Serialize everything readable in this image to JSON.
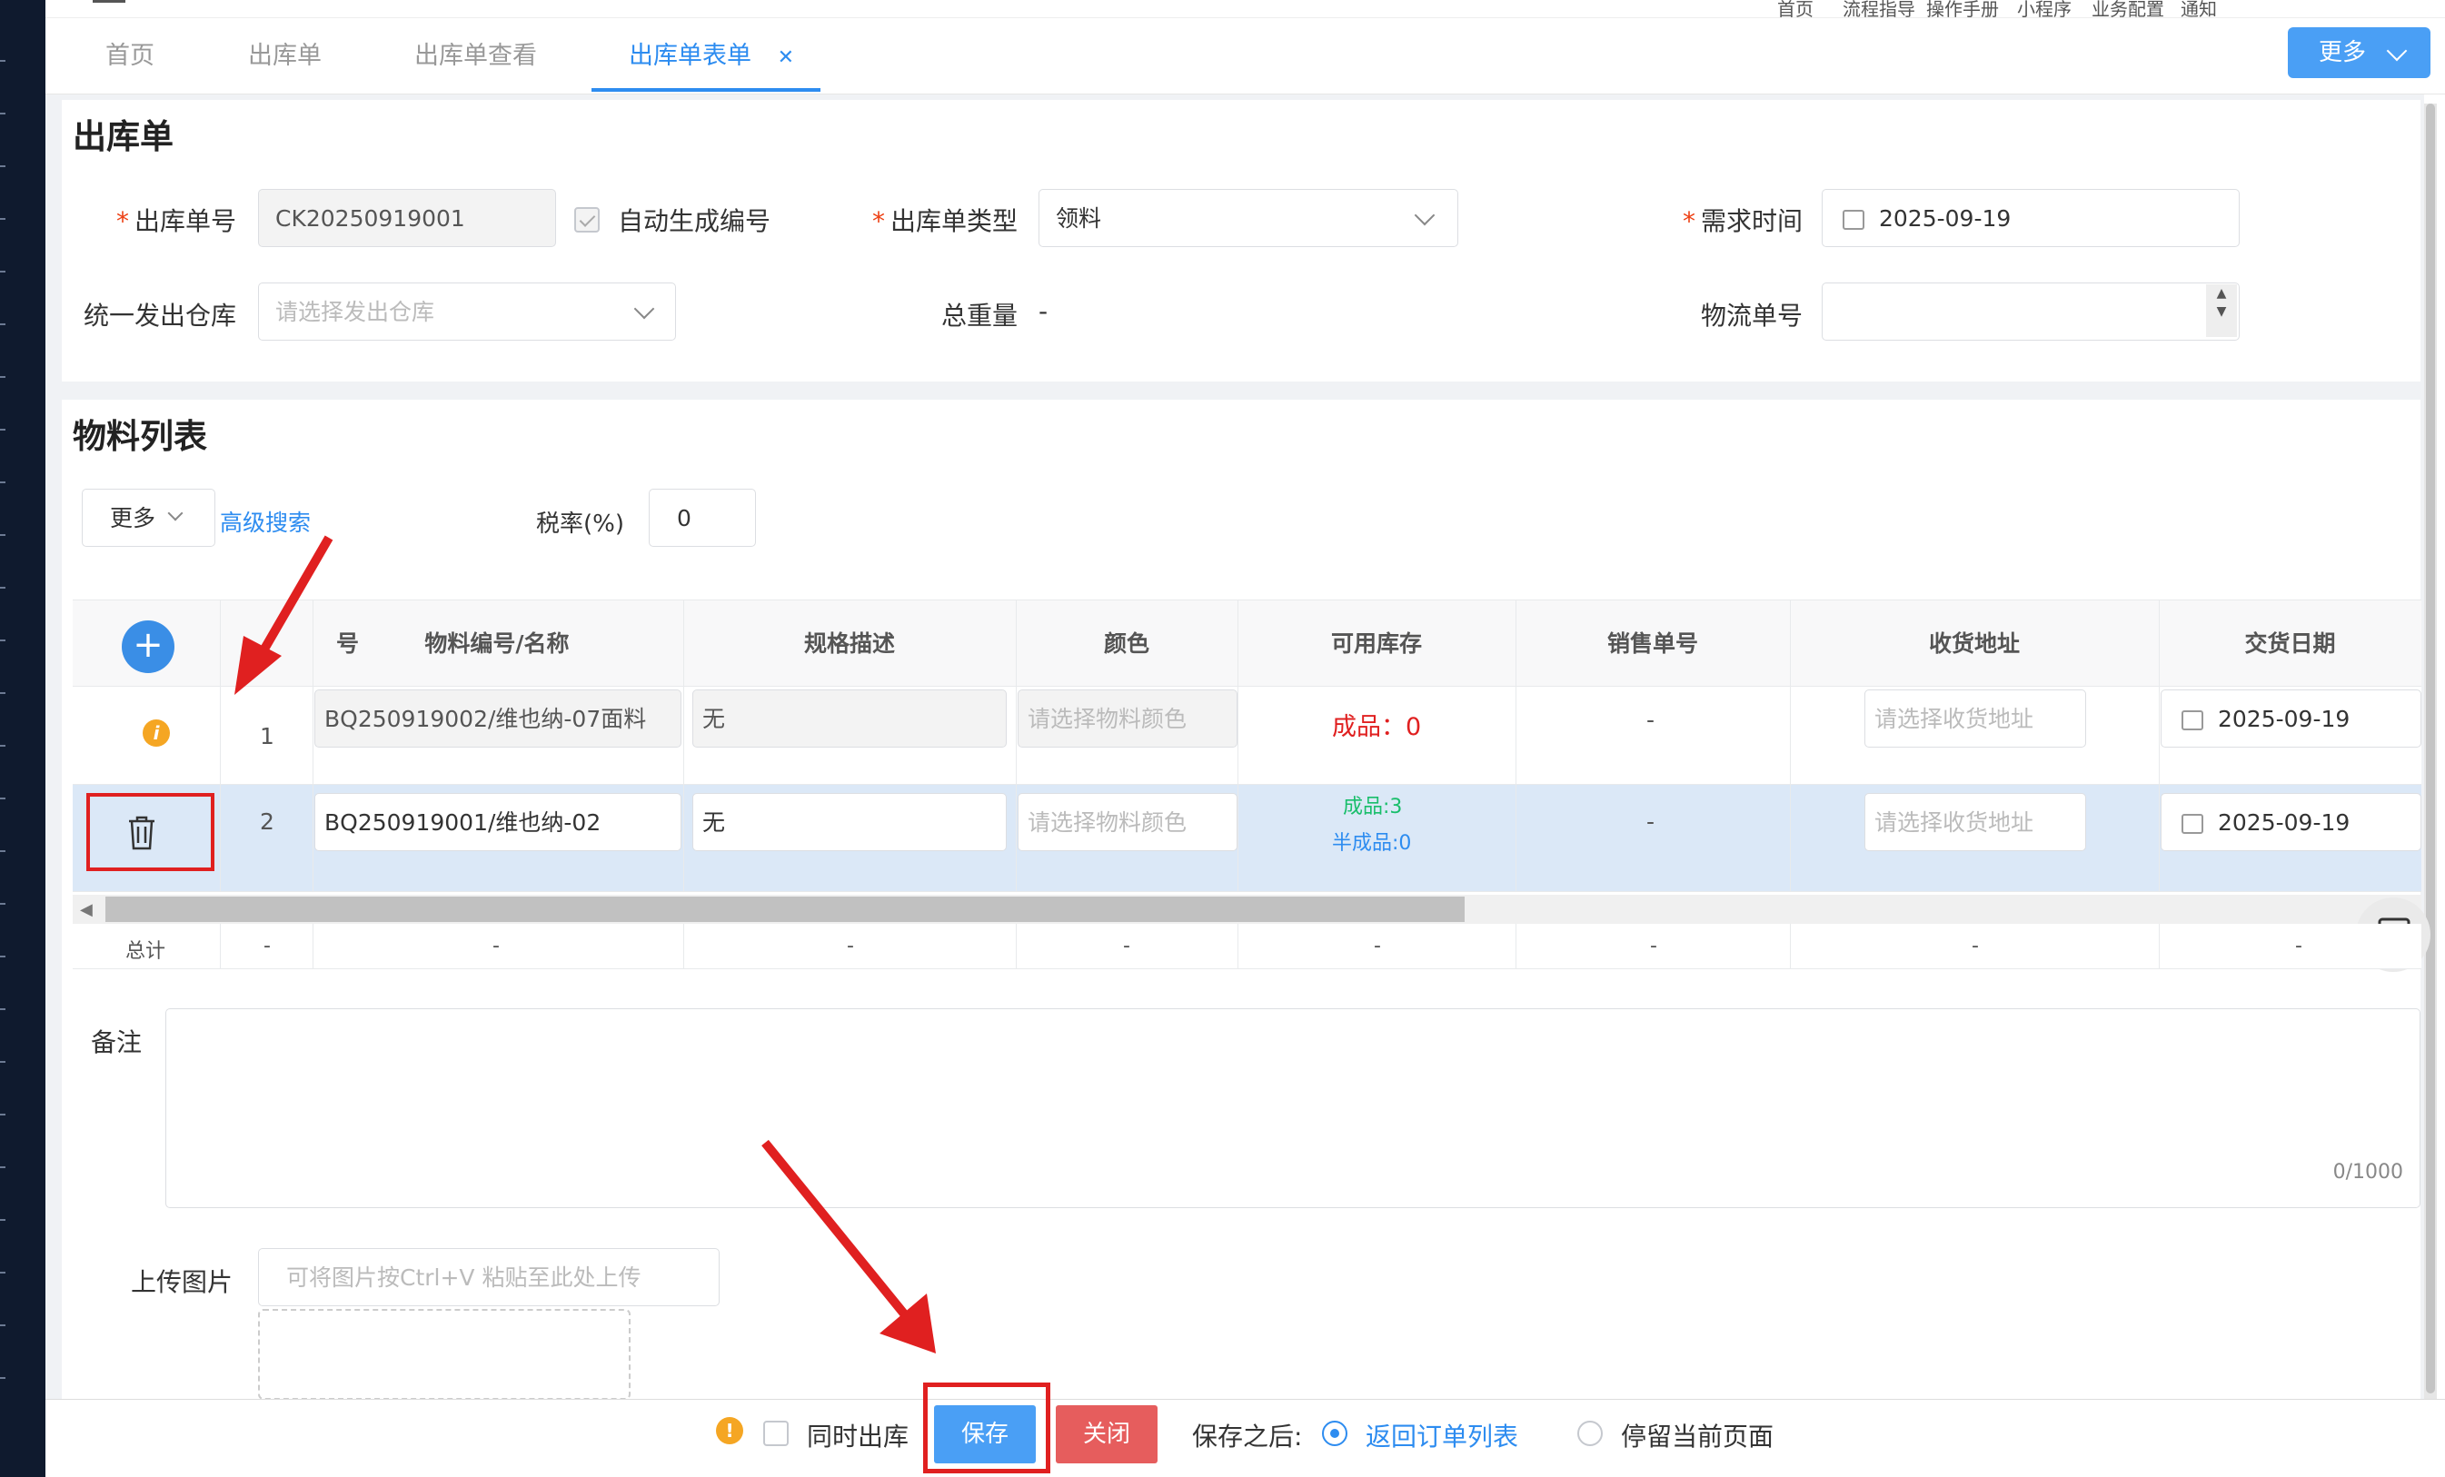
{
  "top_links": [
    "首页",
    "流程指导",
    "操作手册",
    "小程序",
    "业务配置",
    "通知"
  ],
  "tabs": [
    {
      "label": "首页",
      "active": false
    },
    {
      "label": "出库单",
      "active": false
    },
    {
      "label": "出库单查看",
      "active": false
    },
    {
      "label": "出库单表单",
      "active": true
    }
  ],
  "more_button": "更多",
  "form": {
    "title": "出库单",
    "order_no_label": "出库单号",
    "order_no_value": "CK20250919001",
    "auto_generate_label": "自动生成编号",
    "auto_generate_checked": true,
    "type_label": "出库单类型",
    "type_value": "领料",
    "demand_time_label": "需求时间",
    "demand_time_value": "2025-09-19",
    "warehouse_label": "统一发出仓库",
    "warehouse_placeholder": "请选择发出仓库",
    "total_weight_label": "总重量",
    "total_weight_value": "-",
    "logistics_label": "物流单号",
    "logistics_value": ""
  },
  "materials": {
    "title": "物料列表",
    "more_label": "更多",
    "advanced_search": "高级搜索",
    "tax_label": "税率(%)",
    "tax_value": "0",
    "columns": {
      "seq": "号",
      "code": "物料编号/名称",
      "spec": "规格描述",
      "color": "颜色",
      "stock": "可用库存",
      "sales_no": "销售单号",
      "address": "收货地址",
      "delivery": "交货日期"
    },
    "rows": [
      {
        "seq": "1",
        "code": "BQ250919002/维也纳-07面料",
        "spec": "无",
        "color_placeholder": "请选择物料颜色",
        "stock_label": "成品：0",
        "sales_no": "-",
        "address_placeholder": "请选择收货地址",
        "delivery": "2025-09-19"
      },
      {
        "seq": "2",
        "code": "BQ250919001/维也纳-02",
        "spec": "无",
        "color_placeholder": "请选择物料颜色",
        "stock_finished": "成品:3",
        "stock_semi": "半成品:0",
        "sales_no": "-",
        "address_placeholder": "请选择收货地址",
        "delivery": "2025-09-19"
      }
    ],
    "total_label": "总计",
    "dash": "-"
  },
  "remark_label": "备注",
  "remark_counter": "0/1000",
  "upload_label": "上传图片",
  "upload_placeholder": "可将图片按Ctrl+V 粘贴至此处上传",
  "bottom": {
    "sync_label": "同时出库",
    "save": "保存",
    "close": "关闭",
    "after_save_label": "保存之后:",
    "option_return": "返回订单列表",
    "option_stay": "停留当前页面"
  },
  "colors": {
    "primary": "#2d8cf0",
    "danger": "#e65d5d",
    "highlight": "#e02020",
    "stock_red": "#e02020",
    "stock_green": "#19be6b"
  }
}
